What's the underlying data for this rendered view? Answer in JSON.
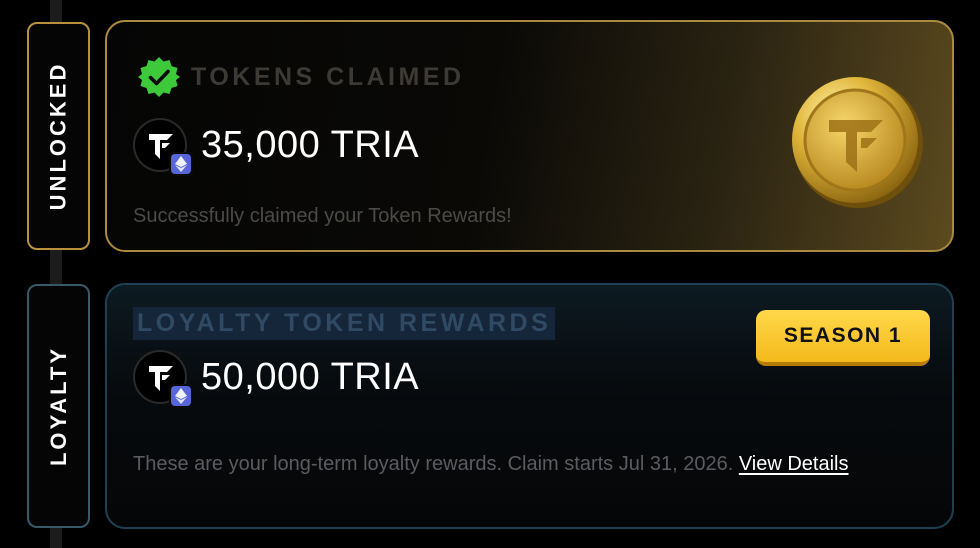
{
  "sections": {
    "unlocked_label": "UNLOCKED",
    "loyalty_label": "LOYALTY"
  },
  "claimed_card": {
    "title": "TOKENS CLAIMED",
    "amount": "35,000 TRIA",
    "description": "Successfully claimed your Token Rewards!",
    "status_icon": "verified-check-icon"
  },
  "loyalty_card": {
    "title": "LOYALTY TOKEN REWARDS",
    "season_badge": "SEASON 1",
    "amount": "50,000 TRIA",
    "description": "These are your long-term loyalty rewards. Claim starts Jul 31, 2026.",
    "link_label": "View Details"
  },
  "colors": {
    "gold_accent": "#b8913a",
    "teal_accent": "#37596a",
    "check_green": "#3ec93a",
    "season_yellow": "#f6c52a",
    "eth_badge": "#5865d8"
  }
}
